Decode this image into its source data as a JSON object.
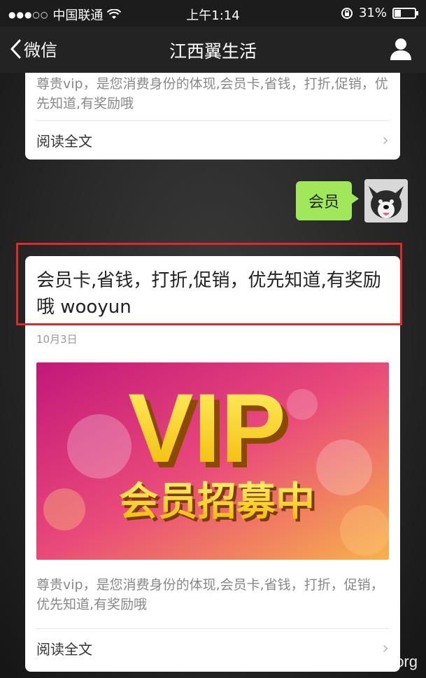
{
  "status_bar": {
    "carrier": "中国联通",
    "time": "上午1:14",
    "battery": "31%",
    "battery_level": 0.31
  },
  "nav": {
    "back_label": "微信",
    "title": "江西翼生活"
  },
  "article_prev": {
    "description": "尊贵vip，是您消费身份的体现,会员卡,省钱，打折,促销，优先知道,有奖励哦",
    "read_more": "阅读全文"
  },
  "user_message": {
    "text": "会员"
  },
  "article": {
    "title": "会员卡,省钱，打折,促销，优先知道,有奖励哦 wooyun",
    "date": "10月3日",
    "cover_text_main": "VIP",
    "cover_text_sub": "会员招募中",
    "description": "尊贵vip，是您消费身份的体现,会员卡,省钱，打折，促销，优先知道,有奖励哦",
    "read_more": "阅读全文"
  },
  "watermark": "www.wooyun.org",
  "colors": {
    "bubble": "#a0e75a",
    "highlight": "#e02828"
  },
  "icons": [
    "signal-dots-icon",
    "wifi-icon",
    "rotation-lock-icon",
    "battery-icon",
    "back-chevron-icon",
    "person-icon",
    "arrow-right-icon"
  ]
}
